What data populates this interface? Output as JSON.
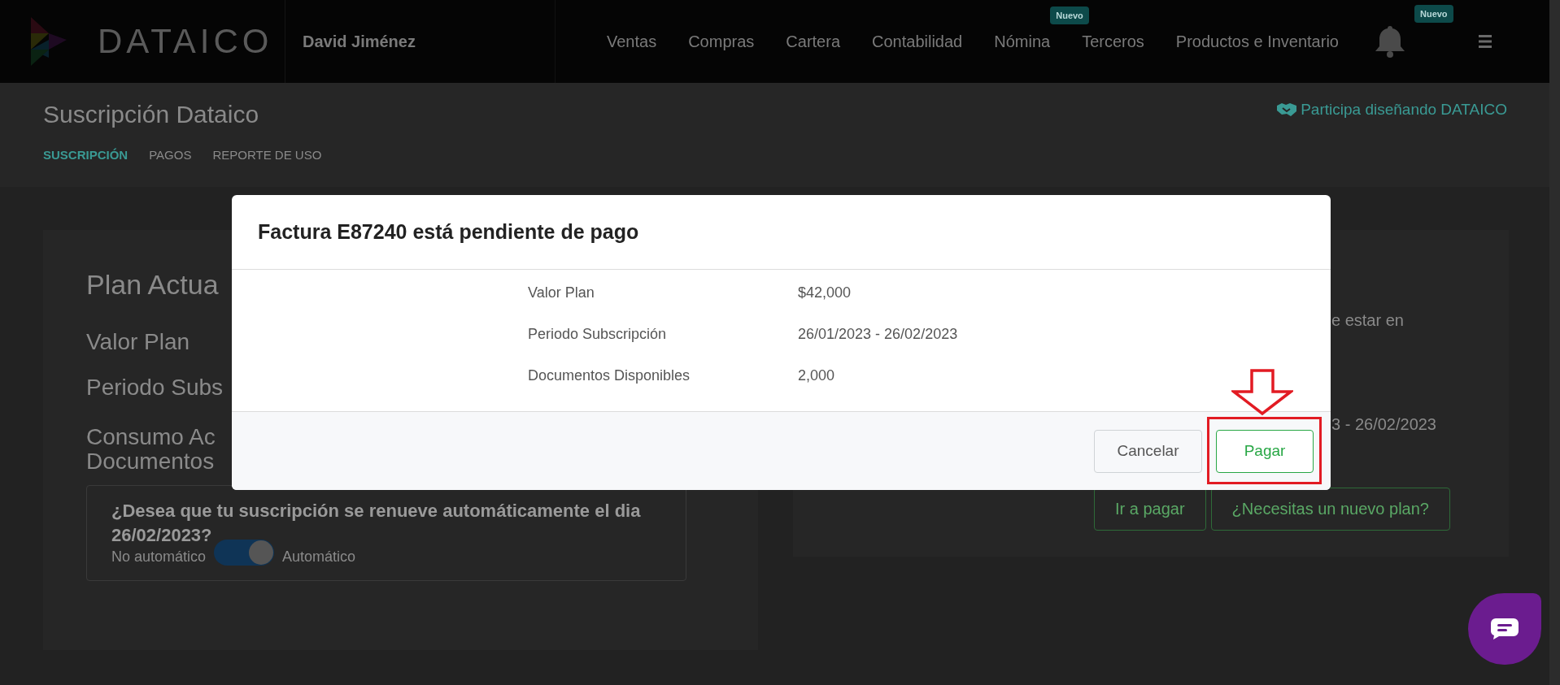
{
  "navbar": {
    "logo": "DATAICO",
    "user": "David Jiménez",
    "items": [
      {
        "label": "Ventas"
      },
      {
        "label": "Compras"
      },
      {
        "label": "Cartera"
      },
      {
        "label": "Contabilidad"
      },
      {
        "label": "Nómina",
        "badge": "Nuevo"
      },
      {
        "label": "Terceros"
      },
      {
        "label": "Productos e Inventario"
      }
    ],
    "bell_badge": "Nuevo"
  },
  "page": {
    "title": "Suscripción Dataico",
    "tabs": [
      {
        "label": "SUSCRIPCIÓN",
        "selected": true
      },
      {
        "label": "PAGOS",
        "selected": false
      },
      {
        "label": "REPORTE DE USO",
        "selected": false
      }
    ],
    "participate_link": "Participa diseñando DATAICO"
  },
  "plan_card": {
    "title": "Plan Actua",
    "rows": [
      "Valor Plan",
      "Periodo Subs"
    ],
    "consumption_lines": [
      "Consumo Ac",
      "Documentos"
    ],
    "renewal": {
      "question": "¿Desea que tu suscripción se renueve automáticamente el dia 26/02/2023?",
      "off_label": "No automático",
      "on_label": "Automático",
      "on": true
    }
  },
  "right_card": {
    "fragments": [
      "e estar en",
      "3 - 26/02/2023"
    ],
    "buttons": [
      "Ir a pagar",
      "¿Necesitas un nuevo plan?"
    ]
  },
  "modal": {
    "title": "Factura E87240 está pendiente de pago",
    "rows": [
      {
        "label": "Valor Plan",
        "value": "$42,000"
      },
      {
        "label": "Periodo Subscripción",
        "value": "26/01/2023 - 26/02/2023"
      },
      {
        "label": "Documentos Disponibles",
        "value": "2,000"
      }
    ],
    "buttons": [
      {
        "label": "Cancelar",
        "kind": "secondary",
        "highlighted": false
      },
      {
        "label": "Pagar",
        "kind": "primary",
        "highlighted": true
      }
    ]
  }
}
